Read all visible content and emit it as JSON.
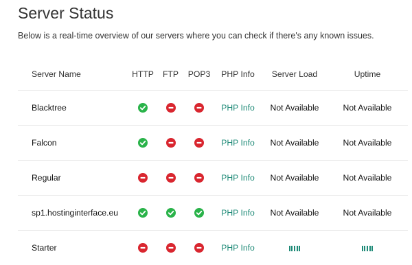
{
  "page": {
    "title": "Server Status",
    "description": "Below is a real-time overview of our servers where you can check if there's any known issues."
  },
  "colors": {
    "ok": "#2ab34a",
    "down": "#d9262f",
    "link": "#1e8a77"
  },
  "table": {
    "headers": {
      "name": "Server Name",
      "http": "HTTP",
      "ftp": "FTP",
      "pop3": "POP3",
      "php": "PHP Info",
      "load": "Server Load",
      "uptime": "Uptime"
    },
    "rows": [
      {
        "name": "Blacktree",
        "http": "up",
        "ftp": "down",
        "pop3": "down",
        "php": "PHP Info",
        "load": "Not Available",
        "uptime": "Not Available"
      },
      {
        "name": "Falcon",
        "http": "up",
        "ftp": "down",
        "pop3": "down",
        "php": "PHP Info",
        "load": "Not Available",
        "uptime": "Not Available"
      },
      {
        "name": "Regular",
        "http": "down",
        "ftp": "down",
        "pop3": "down",
        "php": "PHP Info",
        "load": "Not Available",
        "uptime": "Not Available"
      },
      {
        "name": "sp1.hostinginterface.eu",
        "http": "up",
        "ftp": "up",
        "pop3": "up",
        "php": "PHP Info",
        "load": "Not Available",
        "uptime": "Not Available"
      },
      {
        "name": "Starter",
        "http": "down",
        "ftp": "down",
        "pop3": "down",
        "php": "PHP Info",
        "load": "loading-indicator",
        "uptime": "loading-indicator"
      }
    ]
  }
}
